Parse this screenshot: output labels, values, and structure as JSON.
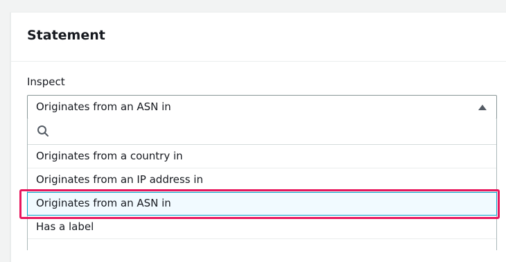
{
  "panel": {
    "title": "Statement"
  },
  "inspect": {
    "label": "Inspect",
    "selected_value": "Originates from an ASN in",
    "search": {
      "value": "",
      "placeholder": ""
    },
    "options": [
      {
        "label": "Originates from a country in",
        "selected": false
      },
      {
        "label": "Originates from an IP address in",
        "selected": false
      },
      {
        "label": "Originates from an ASN in",
        "selected": true
      },
      {
        "label": "Has a label",
        "selected": false
      }
    ]
  },
  "icons": {
    "search": "search-icon",
    "caret": "caret-up-icon"
  },
  "colors": {
    "highlight_frame": "#e8175d",
    "selected_option_bg": "#f1faff",
    "selected_option_border": "#00a1c9"
  }
}
